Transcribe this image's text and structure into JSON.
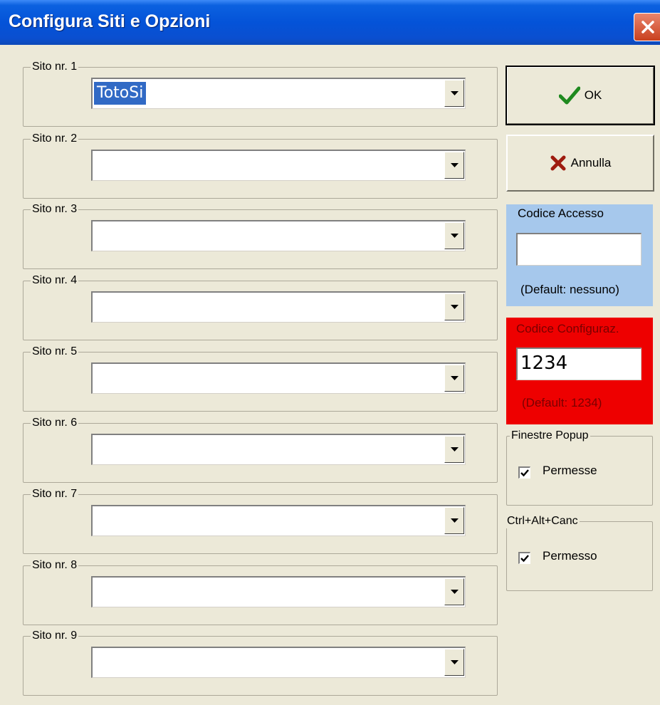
{
  "window": {
    "title": "Configura Siti e Opzioni"
  },
  "icons": {
    "close": "close-icon",
    "ok": "checkmark-icon",
    "cancel": "x-icon",
    "dropdown": "chevron-down-icon",
    "checkbox": "check-icon"
  },
  "sites": [
    {
      "label": "Sito nr. 1",
      "value": "TotoSi"
    },
    {
      "label": "Sito nr. 2",
      "value": ""
    },
    {
      "label": "Sito nr. 3",
      "value": ""
    },
    {
      "label": "Sito nr. 4",
      "value": ""
    },
    {
      "label": "Sito nr. 5",
      "value": ""
    },
    {
      "label": "Sito nr. 6",
      "value": ""
    },
    {
      "label": "Sito nr. 7",
      "value": ""
    },
    {
      "label": "Sito nr. 8",
      "value": ""
    },
    {
      "label": "Sito nr. 9",
      "value": ""
    }
  ],
  "buttons": {
    "ok": "OK",
    "cancel": "Annulla"
  },
  "access_code": {
    "label": "Codice Accesso",
    "value": "",
    "hint": "(Default: nessuno)",
    "bg_color": "#a6c8ec"
  },
  "config_code": {
    "label": "Codice Configuraz.",
    "value": "1234",
    "hint": "(Default: 1234)",
    "bg_color": "#ee0000"
  },
  "popup": {
    "label": "Finestre Popup",
    "checkbox_label": "Permesse",
    "checked": true
  },
  "ctrl_alt_canc": {
    "label": "Ctrl+Alt+Canc",
    "checkbox_label": "Permesso",
    "checked": true
  },
  "colors": {
    "selection": "#316ac5",
    "titlebar": "#0453d8",
    "dialog_bg": "#ece9d8"
  }
}
